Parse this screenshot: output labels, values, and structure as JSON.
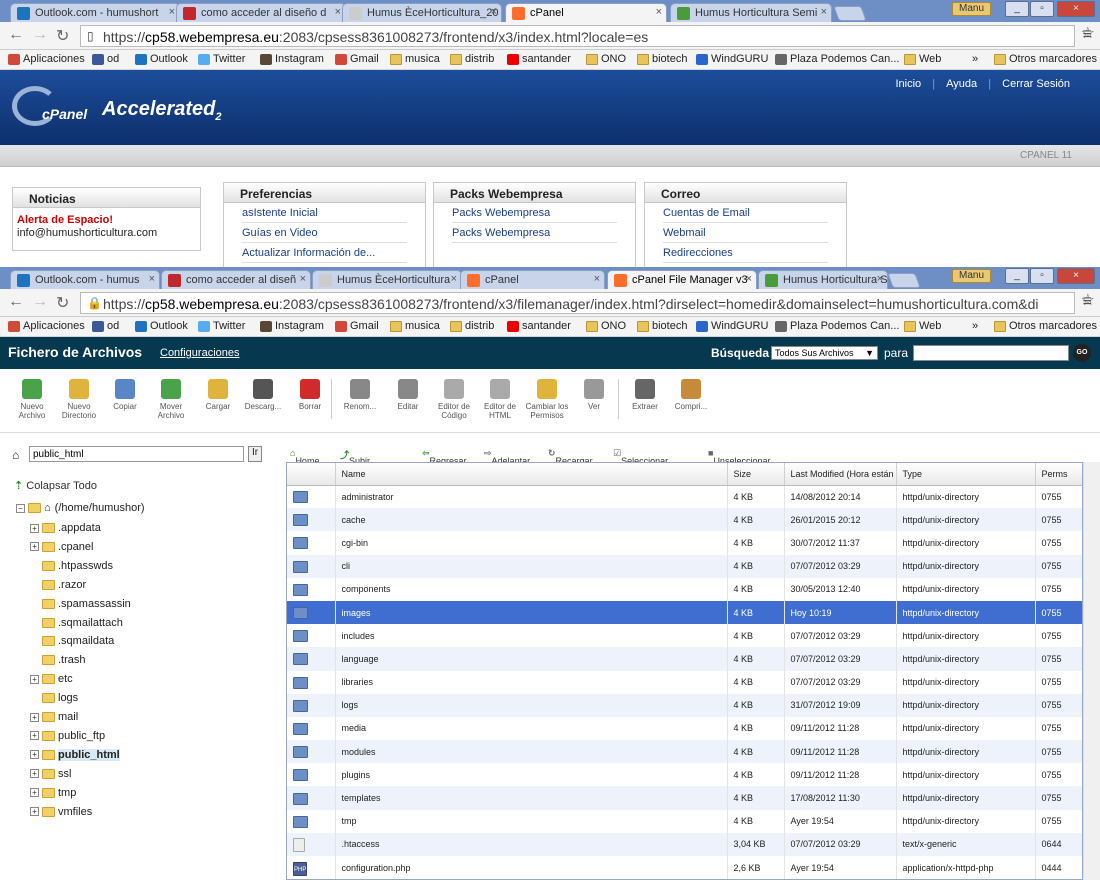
{
  "window1": {
    "tabs": [
      {
        "label": "Outlook.com - humushort",
        "favicon": "outlook-icon",
        "color": "#1e73be"
      },
      {
        "label": "como acceder al diseño d",
        "favicon": "u-icon",
        "color": "#c0282d"
      },
      {
        "label": "Humus ÈceHorticultura_20",
        "favicon": "page-icon",
        "color": "#cccccc"
      },
      {
        "label": "cPanel",
        "favicon": "cpanel-icon",
        "color": "#ff6c2c"
      },
      {
        "label": "Humus Horticultura Semi",
        "favicon": "leaf-icon",
        "color": "#4a9b3a"
      }
    ],
    "user": "Manu",
    "url_scheme": "https://",
    "url_host": "cp58.webempresa.eu",
    "url_rest": ":2083/cpsess8361008273/frontend/x3/index.html?locale=es",
    "cpanel": {
      "brand": "cPanel",
      "accel": "Accelerated",
      "accel_sub": "2",
      "top_links": [
        "Inicio",
        "Ayuda",
        "Cerrar Sesión"
      ],
      "version": "CPANEL 11",
      "noticias": {
        "title": "Noticias",
        "alert": "Alerta de Espacio!",
        "email": "info@humushorticultura.com"
      },
      "preferencias": {
        "title": "Preferencias",
        "links": [
          "asIstente Inicial",
          "Guías en Video",
          "Actualizar Información de..."
        ]
      },
      "packs": {
        "title": "Packs Webempresa",
        "links": [
          "Packs Webempresa",
          "Packs Webempresa",
          ""
        ]
      },
      "correo": {
        "title": "Correo",
        "links": [
          "Cuentas de Email",
          "Webmail",
          "Redirecciones"
        ]
      }
    }
  },
  "bookmarks": [
    {
      "label": "Aplicaciones",
      "icon": "apps-icon",
      "color": "#d04a3a"
    },
    {
      "label": "od",
      "icon": "facebook-icon",
      "color": "#3b5998"
    },
    {
      "label": "Outlook",
      "icon": "outlook-icon",
      "color": "#1e73be"
    },
    {
      "label": "Twitter",
      "icon": "twitter-icon",
      "color": "#55acee"
    },
    {
      "label": "Instagram",
      "icon": "instagram-icon",
      "color": "#5a4634"
    },
    {
      "label": "Gmail",
      "icon": "gmail-icon",
      "color": "#d44638"
    },
    {
      "label": "musica",
      "icon": "folder-icon",
      "color": ""
    },
    {
      "label": "distrib",
      "icon": "folder-icon",
      "color": ""
    },
    {
      "label": "santander",
      "icon": "santander-icon",
      "color": "#ec0000"
    },
    {
      "label": "ONO",
      "icon": "folder-icon",
      "color": ""
    },
    {
      "label": "biotech",
      "icon": "folder-icon",
      "color": ""
    },
    {
      "label": "WindGURU",
      "icon": "windguru-icon",
      "color": "#2a66c9"
    },
    {
      "label": "Plaza Podemos Can...",
      "icon": "podemos-icon",
      "color": "#666666"
    },
    {
      "label": "Web",
      "icon": "folder-icon",
      "color": ""
    }
  ],
  "bookmarks_more": "»",
  "bookmarks_other": "Otros marcadores",
  "window2": {
    "tabs": [
      {
        "label": "Outlook.com - humus",
        "favicon": "outlook-icon",
        "color": "#1e73be"
      },
      {
        "label": "como acceder al diseñ",
        "favicon": "u-icon",
        "color": "#c0282d"
      },
      {
        "label": "Humus ÈceHorticultura",
        "favicon": "page-icon",
        "color": "#cccccc"
      },
      {
        "label": "cPanel",
        "favicon": "cpanel-icon",
        "color": "#ff6c2c"
      },
      {
        "label": "cPanel File Manager v3",
        "favicon": "cpanel-icon",
        "color": "#ff6c2c"
      },
      {
        "label": "Humus Horticultura Se",
        "favicon": "leaf-icon",
        "color": "#4a9b3a"
      }
    ],
    "user": "Manu",
    "url_scheme": "https://",
    "url_host": "cp58.webempresa.eu",
    "url_rest": ":2083/cpsess8361008273/frontend/x3/filemanager/index.html?dirselect=homedir&domainselect=humushorticultura.com&di",
    "fm": {
      "title": "Fichero de Archivos",
      "config": "Configuraciones",
      "search_label": "Búsqueda",
      "search_scope": "Todos Sus Archivos",
      "search_para": "para",
      "go": "GO",
      "tools": [
        {
          "label": "Nuevo Archivo",
          "icon": "new-file-icon",
          "color": "#4aa34a"
        },
        {
          "label": "Nuevo Directorio",
          "icon": "new-folder-icon",
          "color": "#e0b43c"
        },
        {
          "label": "Copiar",
          "icon": "copy-icon",
          "color": "#5a86c8"
        },
        {
          "label": "Mover Archivo",
          "icon": "move-icon",
          "color": "#4aa34a"
        },
        {
          "label": "Cargar",
          "icon": "upload-icon",
          "color": "#e0b43c"
        },
        {
          "label": "Descarg...",
          "icon": "download-icon",
          "color": "#555555"
        },
        {
          "label": "Borrar",
          "icon": "delete-icon",
          "color": "#d02a2a"
        },
        {
          "label": "Renom...",
          "icon": "rename-icon",
          "color": "#888888"
        },
        {
          "label": "Editar",
          "icon": "edit-icon",
          "color": "#888888"
        },
        {
          "label": "Editor de Código",
          "icon": "code-editor-icon",
          "color": "#aaaaaa"
        },
        {
          "label": "Editor de HTML",
          "icon": "html-editor-icon",
          "color": "#aaaaaa"
        },
        {
          "label": "Cambiar los Permisos",
          "icon": "key-icon",
          "color": "#e0b43c"
        },
        {
          "label": "Ver",
          "icon": "view-icon",
          "color": "#999999"
        },
        {
          "label": "Extraer",
          "icon": "extract-icon",
          "color": "#666666"
        },
        {
          "label": "Compri...",
          "icon": "compress-icon",
          "color": "#c78a3a"
        }
      ],
      "path": "public_html",
      "path_go": "Ir",
      "collapse": "Colapsar Todo",
      "root": "(/home/humushor)",
      "tree": [
        {
          "label": ".appdata",
          "pm": true
        },
        {
          "label": ".cpanel",
          "pm": true
        },
        {
          "label": ".htpasswds",
          "pm": false
        },
        {
          "label": ".razor",
          "pm": false
        },
        {
          "label": ".spamassassin",
          "pm": false
        },
        {
          "label": ".sqmailattach",
          "pm": false
        },
        {
          "label": ".sqmaildata",
          "pm": false
        },
        {
          "label": ".trash",
          "pm": false
        },
        {
          "label": "etc",
          "pm": true
        },
        {
          "label": "logs",
          "pm": false
        },
        {
          "label": "mail",
          "pm": true
        },
        {
          "label": "public_ftp",
          "pm": true
        },
        {
          "label": "public_html",
          "pm": true
        },
        {
          "label": "ssl",
          "pm": true
        },
        {
          "label": "tmp",
          "pm": true
        },
        {
          "label": "vmfiles",
          "pm": true
        }
      ],
      "nav": [
        "Home",
        "Subir un nivel",
        "Regresar",
        "Adelantar",
        "Recargar",
        "Seleccionar todo",
        "Unseleccionar todo"
      ],
      "columns": [
        "Name",
        "Size",
        "Last Modified (Hora están",
        "Type",
        "Perms"
      ],
      "rows": [
        {
          "name": "administrator",
          "size": "4 KB",
          "date": "14/08/2012 20:14",
          "type": "httpd/unix-directory",
          "perms": "0755",
          "kind": "dir"
        },
        {
          "name": "cache",
          "size": "4 KB",
          "date": "26/01/2015 20:12",
          "type": "httpd/unix-directory",
          "perms": "0755",
          "kind": "dir"
        },
        {
          "name": "cgi-bin",
          "size": "4 KB",
          "date": "30/07/2012 11:37",
          "type": "httpd/unix-directory",
          "perms": "0755",
          "kind": "dir"
        },
        {
          "name": "cli",
          "size": "4 KB",
          "date": "07/07/2012 03:29",
          "type": "httpd/unix-directory",
          "perms": "0755",
          "kind": "dir"
        },
        {
          "name": "components",
          "size": "4 KB",
          "date": "30/05/2013 12:40",
          "type": "httpd/unix-directory",
          "perms": "0755",
          "kind": "dir"
        },
        {
          "name": "images",
          "size": "4 KB",
          "date": "Hoy 10:19",
          "type": "httpd/unix-directory",
          "perms": "0755",
          "kind": "dir"
        },
        {
          "name": "includes",
          "size": "4 KB",
          "date": "07/07/2012 03:29",
          "type": "httpd/unix-directory",
          "perms": "0755",
          "kind": "dir"
        },
        {
          "name": "language",
          "size": "4 KB",
          "date": "07/07/2012 03:29",
          "type": "httpd/unix-directory",
          "perms": "0755",
          "kind": "dir"
        },
        {
          "name": "libraries",
          "size": "4 KB",
          "date": "07/07/2012 03:29",
          "type": "httpd/unix-directory",
          "perms": "0755",
          "kind": "dir"
        },
        {
          "name": "logs",
          "size": "4 KB",
          "date": "31/07/2012 19:09",
          "type": "httpd/unix-directory",
          "perms": "0755",
          "kind": "dir"
        },
        {
          "name": "media",
          "size": "4 KB",
          "date": "09/11/2012 11:28",
          "type": "httpd/unix-directory",
          "perms": "0755",
          "kind": "dir"
        },
        {
          "name": "modules",
          "size": "4 KB",
          "date": "09/11/2012 11:28",
          "type": "httpd/unix-directory",
          "perms": "0755",
          "kind": "dir"
        },
        {
          "name": "plugins",
          "size": "4 KB",
          "date": "09/11/2012 11:28",
          "type": "httpd/unix-directory",
          "perms": "0755",
          "kind": "dir"
        },
        {
          "name": "templates",
          "size": "4 KB",
          "date": "17/08/2012 11:30",
          "type": "httpd/unix-directory",
          "perms": "0755",
          "kind": "dir"
        },
        {
          "name": "tmp",
          "size": "4 KB",
          "date": "Ayer 19:54",
          "type": "httpd/unix-directory",
          "perms": "0755",
          "kind": "dir"
        },
        {
          "name": ".htaccess",
          "size": "3,04 KB",
          "date": "07/07/2012 03:29",
          "type": "text/x-generic",
          "perms": "0644",
          "kind": "file"
        },
        {
          "name": "configuration.php",
          "size": "2,6 KB",
          "date": "Ayer 19:54",
          "type": "application/x-httpd-php",
          "perms": "0444",
          "kind": "php"
        }
      ],
      "selected_row": 5
    }
  }
}
